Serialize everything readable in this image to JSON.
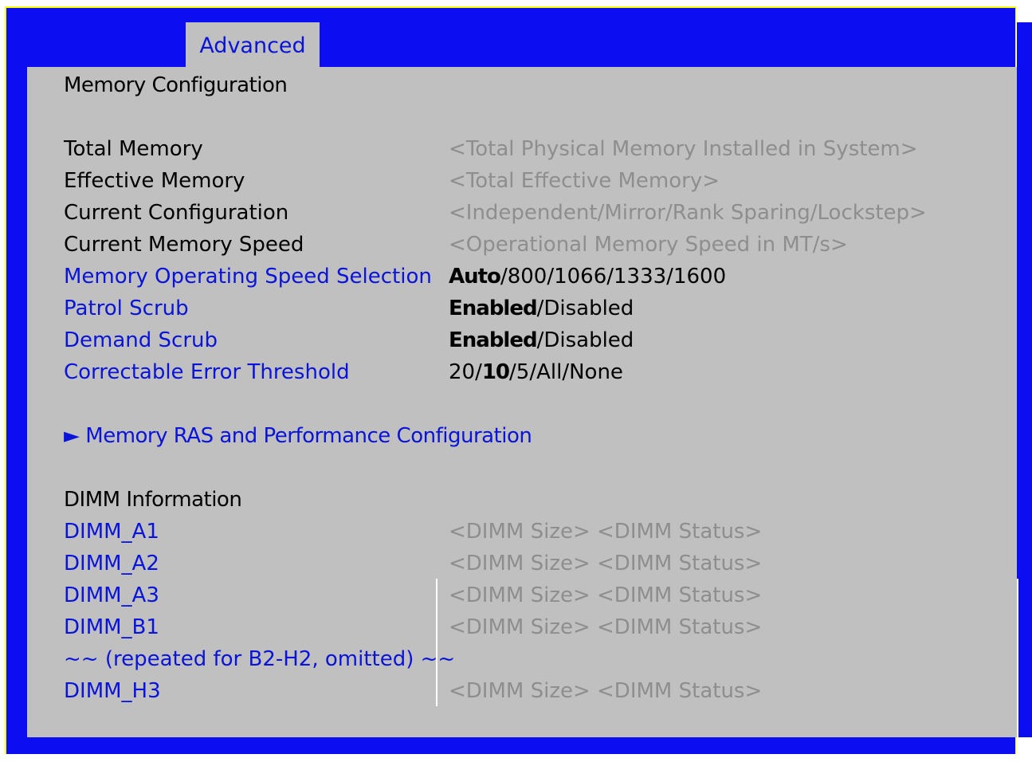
{
  "tab": {
    "label": "Advanced"
  },
  "page_title": "Memory Configuration",
  "info_rows": [
    {
      "label": "Total Memory",
      "value": "<Total Physical Memory Installed in System>"
    },
    {
      "label": "Effective Memory",
      "value": "<Total Effective Memory>"
    },
    {
      "label": "Current Configuration",
      "value": "<Independent/Mirror/Rank Sparing/Lockstep>"
    },
    {
      "label": "Current Memory Speed",
      "value": "<Operational Memory Speed in MT/s>"
    }
  ],
  "settings": [
    {
      "label": "Memory Operating Speed Selection",
      "prefix": "",
      "default": "Auto",
      "suffix": "/800/1066/1333/1600"
    },
    {
      "label": "Patrol Scrub",
      "prefix": "",
      "default": "Enabled",
      "suffix": "/Disabled"
    },
    {
      "label": "Demand Scrub",
      "prefix": "",
      "default": "Enabled",
      "suffix": "/Disabled"
    },
    {
      "label": "Correctable Error Threshold",
      "prefix": "20/",
      "default": "10",
      "suffix": "/5/All/None"
    }
  ],
  "submenu": {
    "arrow": "►",
    "label": "Memory RAS and Performance Configuration"
  },
  "dimm_section_title": "DIMM Information",
  "dimms": [
    {
      "label": "DIMM_A1",
      "value": "<DIMM Size> <DIMM Status>"
    },
    {
      "label": "DIMM_A2",
      "value": "<DIMM Size> <DIMM Status>"
    },
    {
      "label": "DIMM_A3",
      "value": "<DIMM Size> <DIMM Status>"
    },
    {
      "label": "DIMM_B1",
      "value": "<DIMM Size> <DIMM Status>"
    },
    {
      "label": "~~ (repeated for B2-H2, omitted) ~~",
      "value": ""
    },
    {
      "label": "DIMM_H3",
      "value": "<DIMM Size> <DIMM Status>"
    }
  ],
  "colors": {
    "background_blue": "#0d0df2",
    "border_yellow": "#fdfd00",
    "panel_gray": "#c0c0c0",
    "link_blue": "#0a14d8",
    "value_gray": "#8e8e8e"
  }
}
